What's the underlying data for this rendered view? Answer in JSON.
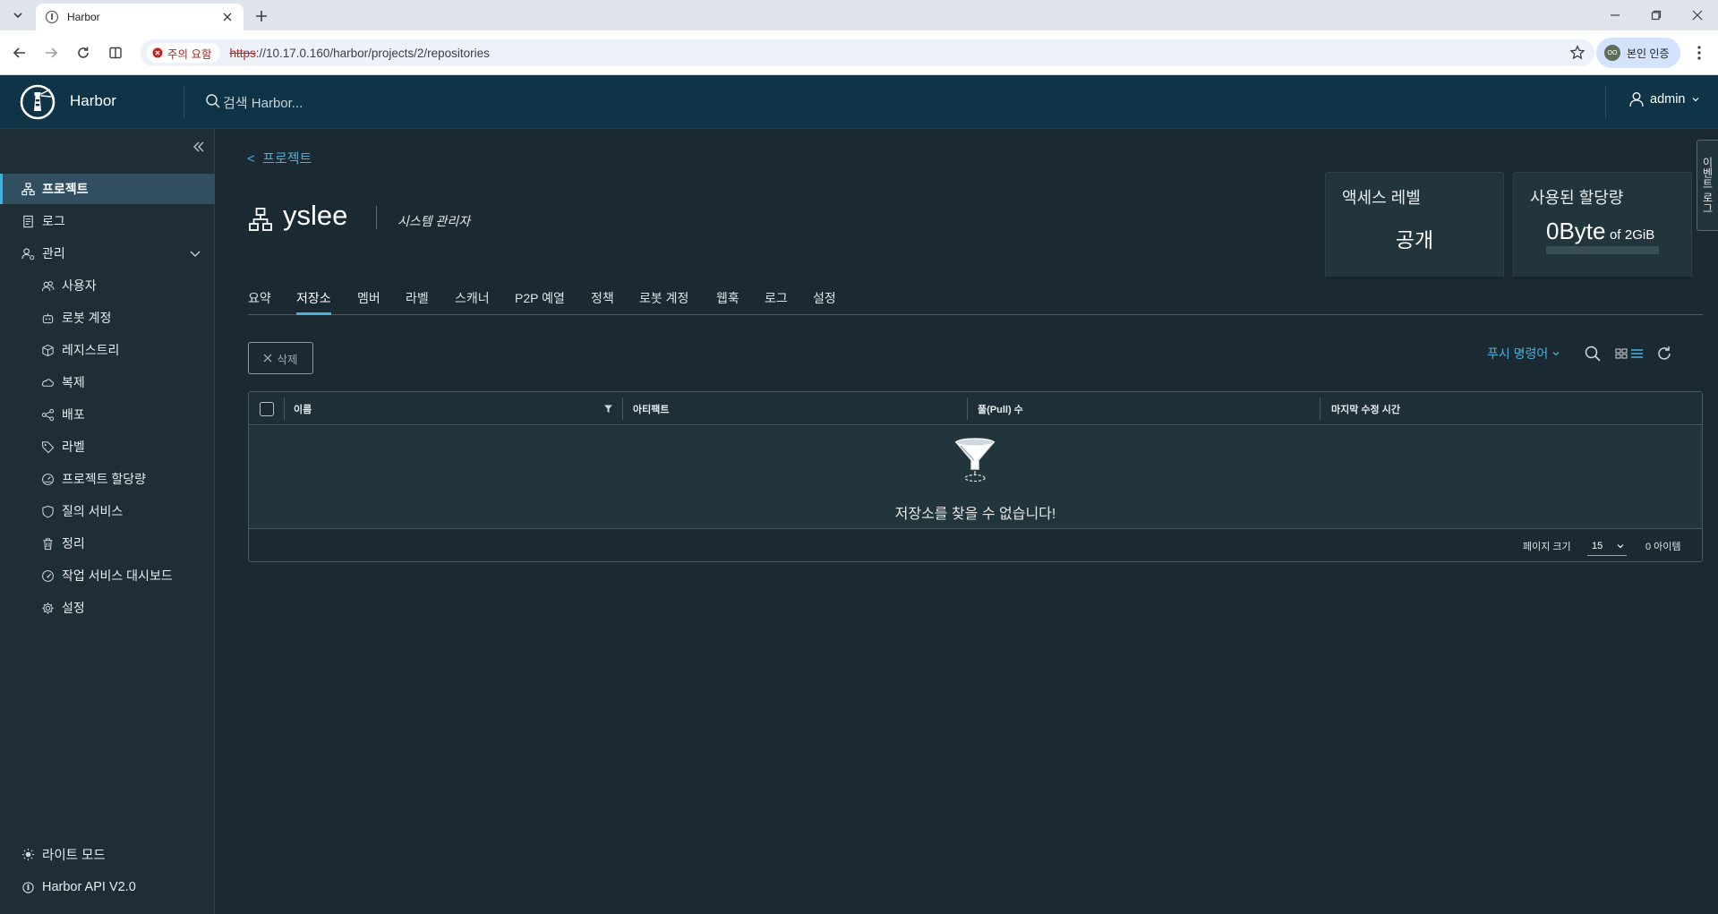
{
  "browser": {
    "tab_title": "Harbor",
    "security_label": "주의 요함",
    "url_protocol": "https",
    "url_rest": "://10.17.0.160/harbor/projects/2/repositories",
    "profile_label": "본인 인증",
    "profile_initials": "OO"
  },
  "header": {
    "app_name": "Harbor",
    "search_placeholder": "검색 Harbor...",
    "user": "admin"
  },
  "sidebar": {
    "items": [
      {
        "label": "프로젝트",
        "icon": "projects-icon",
        "active": true
      },
      {
        "label": "로그",
        "icon": "log-icon"
      },
      {
        "label": "관리",
        "icon": "admin-icon"
      },
      {
        "label": "사용자",
        "icon": "users-icon"
      },
      {
        "label": "로봇 계정",
        "icon": "robot-icon"
      },
      {
        "label": "레지스트리",
        "icon": "registry-icon"
      },
      {
        "label": "복제",
        "icon": "replication-icon"
      },
      {
        "label": "배포",
        "icon": "distribution-icon"
      },
      {
        "label": "라벨",
        "icon": "label-icon"
      },
      {
        "label": "프로젝트 할당량",
        "icon": "quota-icon"
      },
      {
        "label": "질의 서비스",
        "icon": "interrogation-icon"
      },
      {
        "label": "정리",
        "icon": "clean-icon"
      },
      {
        "label": "작업 서비스 대시보드",
        "icon": "dashboard-icon"
      },
      {
        "label": "설정",
        "icon": "settings-icon"
      }
    ],
    "light_mode": "라이트 모드",
    "api": "Harbor API V2.0"
  },
  "project": {
    "back_label": "프로젝트",
    "name": "yslee",
    "role": "시스템 관리자",
    "access_level_title": "액세스 레벨",
    "access_level_value": "공개",
    "quota_title": "사용된 할당량",
    "quota_used": "0Byte",
    "quota_of": "of",
    "quota_total": "2GiB",
    "quota_fraction": 0,
    "event_tab": "이벤트 로그"
  },
  "tabs": [
    "요약",
    "저장소",
    "멤버",
    "라벨",
    "스캐너",
    "P2P 예열",
    "정책",
    "로봇 계정",
    "웹훅",
    "로그",
    "설정"
  ],
  "toolbar": {
    "delete_label": "삭제",
    "push_command_label": "푸시 명령어"
  },
  "grid": {
    "columns": [
      "이름",
      "아티팩트",
      "풀(Pull) 수",
      "마지막 수정 시간"
    ],
    "empty_message": "저장소를 찾을 수 없습니다!",
    "page_size_label": "페이지 크기",
    "page_size_value": "15",
    "item_count": "0 아이템"
  }
}
